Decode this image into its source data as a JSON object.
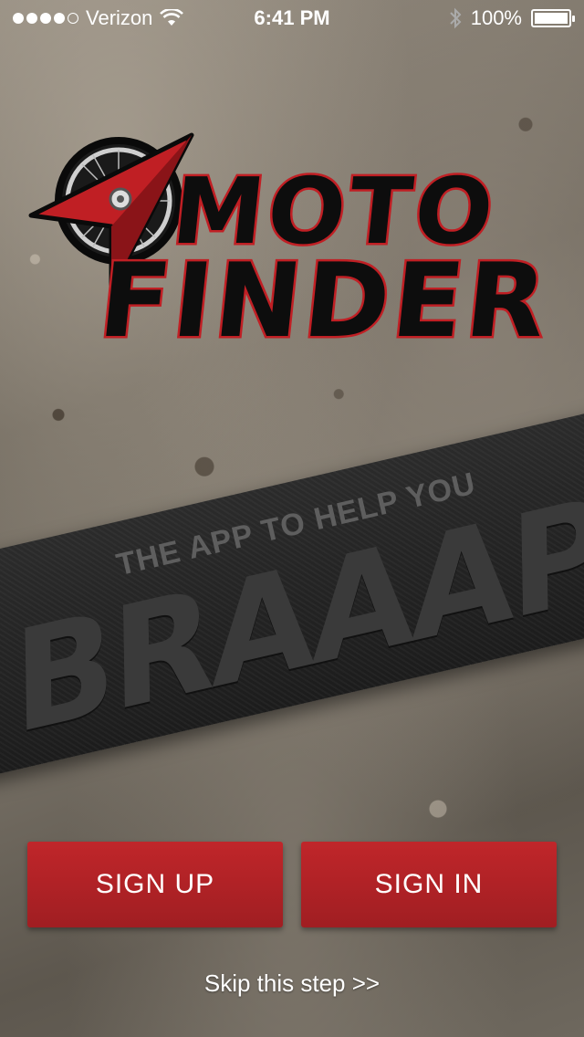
{
  "status_bar": {
    "carrier": "Verizon",
    "time": "6:41 PM",
    "battery": "100%",
    "signal_bars_filled": 4,
    "signal_bars_total": 5
  },
  "logo": {
    "line1": "MOTO",
    "line2": "FINDER",
    "icon": "wheel-arrow-icon"
  },
  "banner": {
    "tagline": "THE APP TO HELP YOU",
    "shout": "BRAAAP!"
  },
  "actions": {
    "sign_up": "SIGN UP",
    "sign_in": "SIGN IN",
    "skip": "Skip this step >>"
  },
  "colors": {
    "accent": "#b82227",
    "logo_fill": "#0d0d0d",
    "banner": "#222222"
  }
}
